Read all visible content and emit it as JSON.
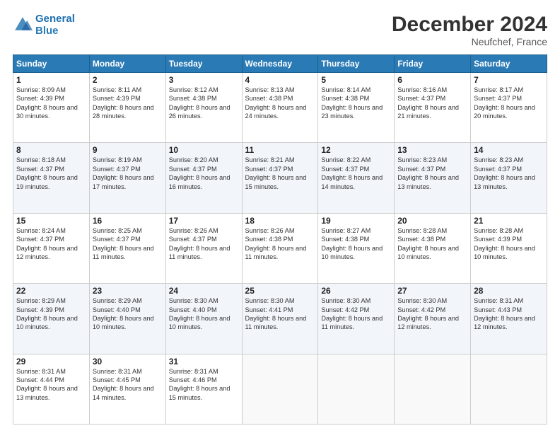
{
  "header": {
    "logo_line1": "General",
    "logo_line2": "Blue",
    "month": "December 2024",
    "location": "Neufchef, France"
  },
  "days_of_week": [
    "Sunday",
    "Monday",
    "Tuesday",
    "Wednesday",
    "Thursday",
    "Friday",
    "Saturday"
  ],
  "weeks": [
    [
      {
        "day": "1",
        "sunrise": "8:09 AM",
        "sunset": "4:39 PM",
        "daylight": "8 hours and 30 minutes."
      },
      {
        "day": "2",
        "sunrise": "8:11 AM",
        "sunset": "4:39 PM",
        "daylight": "8 hours and 28 minutes."
      },
      {
        "day": "3",
        "sunrise": "8:12 AM",
        "sunset": "4:38 PM",
        "daylight": "8 hours and 26 minutes."
      },
      {
        "day": "4",
        "sunrise": "8:13 AM",
        "sunset": "4:38 PM",
        "daylight": "8 hours and 24 minutes."
      },
      {
        "day": "5",
        "sunrise": "8:14 AM",
        "sunset": "4:38 PM",
        "daylight": "8 hours and 23 minutes."
      },
      {
        "day": "6",
        "sunrise": "8:16 AM",
        "sunset": "4:37 PM",
        "daylight": "8 hours and 21 minutes."
      },
      {
        "day": "7",
        "sunrise": "8:17 AM",
        "sunset": "4:37 PM",
        "daylight": "8 hours and 20 minutes."
      }
    ],
    [
      {
        "day": "8",
        "sunrise": "8:18 AM",
        "sunset": "4:37 PM",
        "daylight": "8 hours and 19 minutes."
      },
      {
        "day": "9",
        "sunrise": "8:19 AM",
        "sunset": "4:37 PM",
        "daylight": "8 hours and 17 minutes."
      },
      {
        "day": "10",
        "sunrise": "8:20 AM",
        "sunset": "4:37 PM",
        "daylight": "8 hours and 16 minutes."
      },
      {
        "day": "11",
        "sunrise": "8:21 AM",
        "sunset": "4:37 PM",
        "daylight": "8 hours and 15 minutes."
      },
      {
        "day": "12",
        "sunrise": "8:22 AM",
        "sunset": "4:37 PM",
        "daylight": "8 hours and 14 minutes."
      },
      {
        "day": "13",
        "sunrise": "8:23 AM",
        "sunset": "4:37 PM",
        "daylight": "8 hours and 13 minutes."
      },
      {
        "day": "14",
        "sunrise": "8:23 AM",
        "sunset": "4:37 PM",
        "daylight": "8 hours and 13 minutes."
      }
    ],
    [
      {
        "day": "15",
        "sunrise": "8:24 AM",
        "sunset": "4:37 PM",
        "daylight": "8 hours and 12 minutes."
      },
      {
        "day": "16",
        "sunrise": "8:25 AM",
        "sunset": "4:37 PM",
        "daylight": "8 hours and 11 minutes."
      },
      {
        "day": "17",
        "sunrise": "8:26 AM",
        "sunset": "4:37 PM",
        "daylight": "8 hours and 11 minutes."
      },
      {
        "day": "18",
        "sunrise": "8:26 AM",
        "sunset": "4:38 PM",
        "daylight": "8 hours and 11 minutes."
      },
      {
        "day": "19",
        "sunrise": "8:27 AM",
        "sunset": "4:38 PM",
        "daylight": "8 hours and 10 minutes."
      },
      {
        "day": "20",
        "sunrise": "8:28 AM",
        "sunset": "4:38 PM",
        "daylight": "8 hours and 10 minutes."
      },
      {
        "day": "21",
        "sunrise": "8:28 AM",
        "sunset": "4:39 PM",
        "daylight": "8 hours and 10 minutes."
      }
    ],
    [
      {
        "day": "22",
        "sunrise": "8:29 AM",
        "sunset": "4:39 PM",
        "daylight": "8 hours and 10 minutes."
      },
      {
        "day": "23",
        "sunrise": "8:29 AM",
        "sunset": "4:40 PM",
        "daylight": "8 hours and 10 minutes."
      },
      {
        "day": "24",
        "sunrise": "8:30 AM",
        "sunset": "4:40 PM",
        "daylight": "8 hours and 10 minutes."
      },
      {
        "day": "25",
        "sunrise": "8:30 AM",
        "sunset": "4:41 PM",
        "daylight": "8 hours and 11 minutes."
      },
      {
        "day": "26",
        "sunrise": "8:30 AM",
        "sunset": "4:42 PM",
        "daylight": "8 hours and 11 minutes."
      },
      {
        "day": "27",
        "sunrise": "8:30 AM",
        "sunset": "4:42 PM",
        "daylight": "8 hours and 12 minutes."
      },
      {
        "day": "28",
        "sunrise": "8:31 AM",
        "sunset": "4:43 PM",
        "daylight": "8 hours and 12 minutes."
      }
    ],
    [
      {
        "day": "29",
        "sunrise": "8:31 AM",
        "sunset": "4:44 PM",
        "daylight": "8 hours and 13 minutes."
      },
      {
        "day": "30",
        "sunrise": "8:31 AM",
        "sunset": "4:45 PM",
        "daylight": "8 hours and 14 minutes."
      },
      {
        "day": "31",
        "sunrise": "8:31 AM",
        "sunset": "4:46 PM",
        "daylight": "8 hours and 15 minutes."
      },
      null,
      null,
      null,
      null
    ]
  ],
  "labels": {
    "sunrise": "Sunrise:",
    "sunset": "Sunset:",
    "daylight": "Daylight:"
  }
}
